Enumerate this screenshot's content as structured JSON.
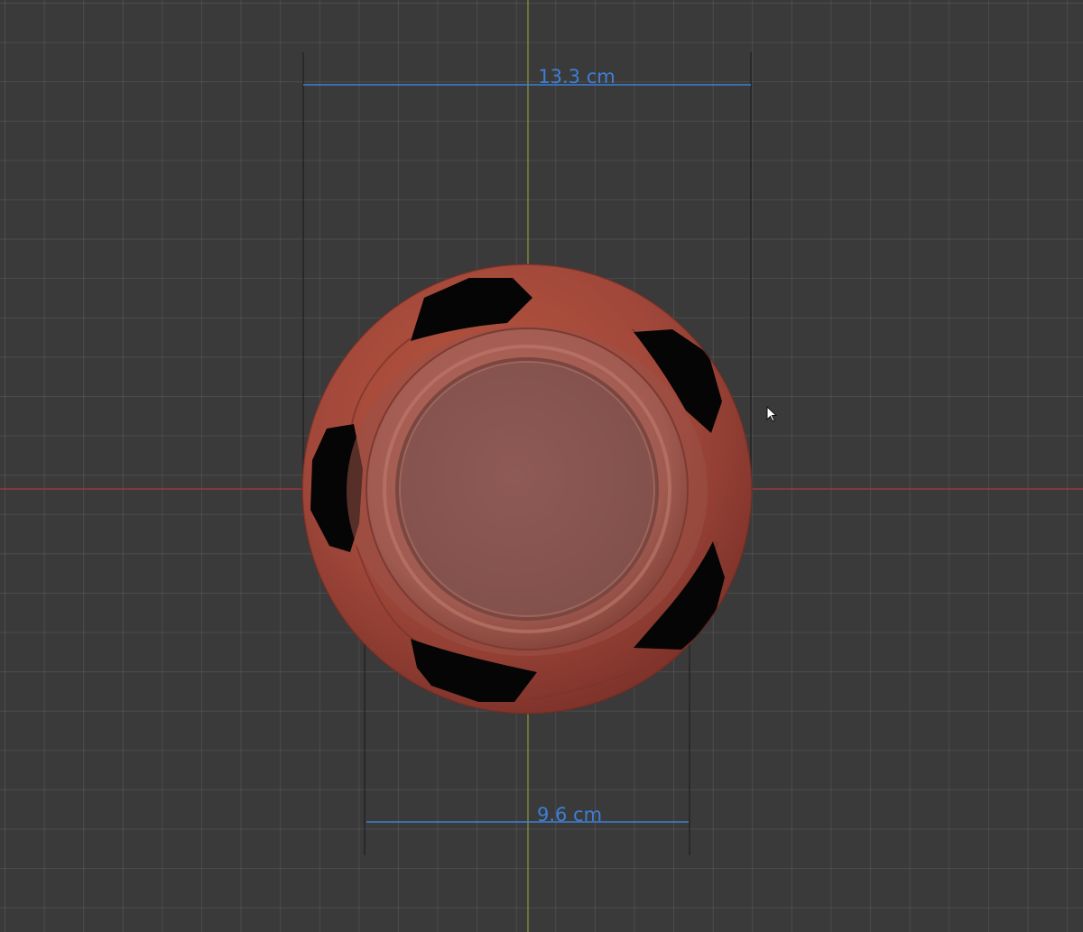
{
  "viewport": {
    "colors": {
      "background": "#3a3a3a",
      "axis_x": "#a83a3a",
      "axis_y": "#8a9a3c",
      "dimension": "#3d7fd6",
      "ball_base": "#a0473a",
      "ball_patch": "#050505",
      "cap_face": "#8a5550"
    }
  },
  "dimensions": {
    "top_width": "13.3 cm",
    "bottom_width": "9.6 cm"
  },
  "cursor": {
    "icon": "arrow-cursor-icon"
  }
}
